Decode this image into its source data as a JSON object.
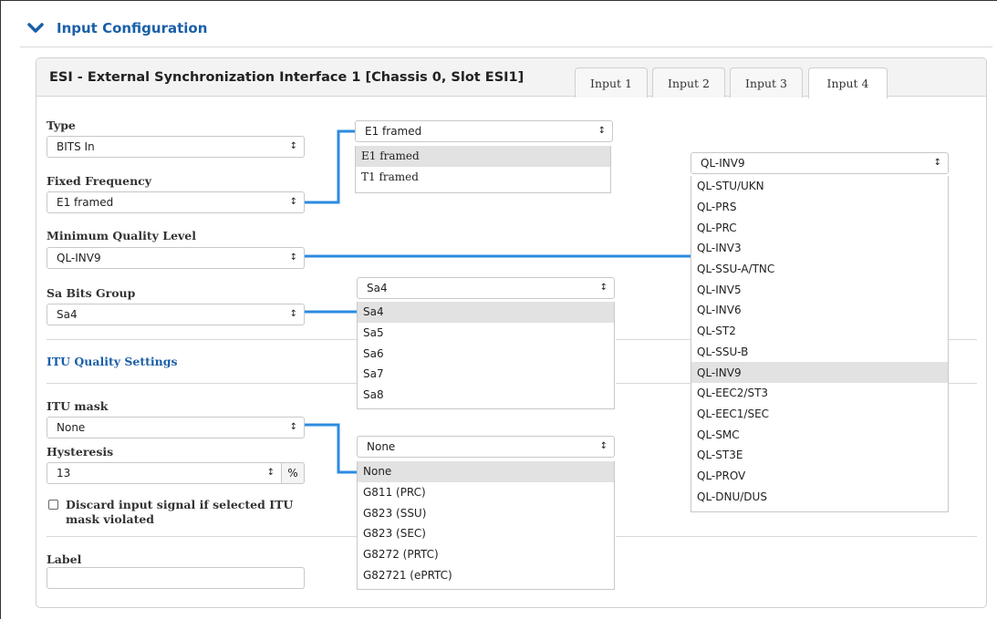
{
  "section": {
    "title": "Input Configuration"
  },
  "panel": {
    "title": "ESI - External Synchronization Interface 1 [Chassis 0, Slot ESI1]",
    "tabs": [
      "Input 1",
      "Input 2",
      "Input 3",
      "Input 4"
    ],
    "active_tab": "Input 4"
  },
  "form": {
    "type_label": "Type",
    "type_value": "BITS In",
    "fixed_frequency_label": "Fixed Frequency",
    "fixed_frequency_value": "E1 framed",
    "mql_label": "Minimum Quality Level",
    "mql_value": "QL-INV9",
    "sa_bits_label": "Sa Bits Group",
    "sa_bits_value": "Sa4",
    "itu_quality_heading": "ITU Quality Settings",
    "itu_mask_label": "ITU mask",
    "itu_mask_value": "None",
    "hysteresis_label": "Hysteresis",
    "hysteresis_value": "13",
    "hysteresis_unit": "%",
    "discard_label_line1": "Discard input signal if selected ITU",
    "discard_label_line2": "mask violated",
    "discard_checked": false,
    "label_label": "Label",
    "label_value": ""
  },
  "dropdowns": {
    "frequency": {
      "value": "E1 framed",
      "options": [
        "E1 framed",
        "T1 framed"
      ],
      "selected": "E1 framed"
    },
    "quality": {
      "value": "QL-INV9",
      "options": [
        "QL-STU/UKN",
        "QL-PRS",
        "QL-PRC",
        "QL-INV3",
        "QL-SSU-A/TNC",
        "QL-INV5",
        "QL-INV6",
        "QL-ST2",
        "QL-SSU-B",
        "QL-INV9",
        "QL-EEC2/ST3",
        "QL-EEC1/SEC",
        "QL-SMC",
        "QL-ST3E",
        "QL-PROV",
        "QL-DNU/DUS"
      ],
      "selected": "QL-INV9"
    },
    "sa_bits": {
      "value": "Sa4",
      "options": [
        "Sa4",
        "Sa5",
        "Sa6",
        "Sa7",
        "Sa8"
      ],
      "selected": "Sa4"
    },
    "itu_mask": {
      "value": "None",
      "options": [
        "None",
        "G811 (PRC)",
        "G823 (SSU)",
        "G823 (SEC)",
        "G8272 (PRTC)",
        "G82721 (ePRTC)"
      ],
      "selected": "None"
    }
  },
  "colors": {
    "accent": "#1a5fa8",
    "connector": "#2b8be0",
    "selected_option_bg": "#e2e2e2"
  },
  "icons": {
    "section_toggle": "chevron-down-icon",
    "select_arrows": "up-down-arrows-icon"
  }
}
